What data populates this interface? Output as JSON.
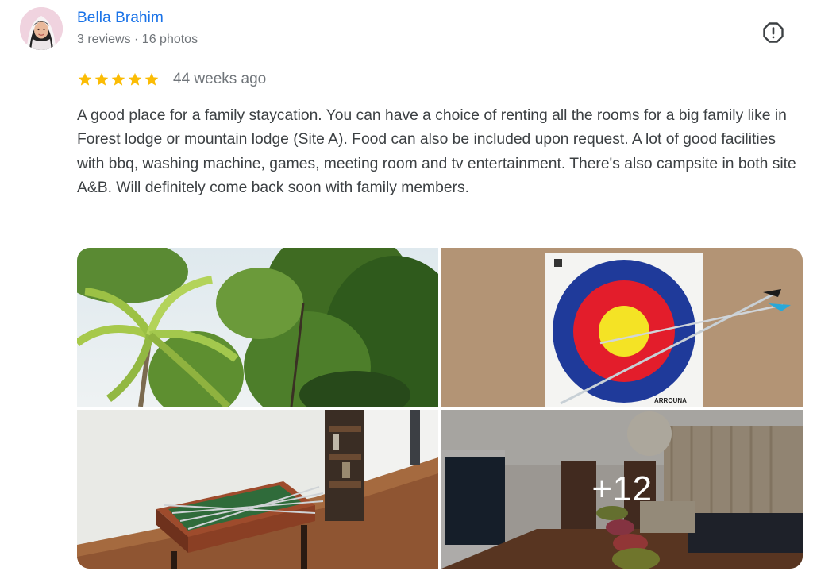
{
  "reviewer": {
    "name": "Bella Brahim",
    "meta": "3 reviews · 16 photos"
  },
  "review": {
    "rating": 5,
    "rating_max": 5,
    "date": "44 weeks ago",
    "text": "A good place for a family staycation. You can have a choice of renting all the rooms for a big family like in Forest lodge or mountain lodge (Site A). Food can also be included upon request. A lot of good facilities with bbq, washing machine, games, meeting room and tv entertainment. There's also campsite in both site A&B. Will definitely come back soon with family members."
  },
  "photos": {
    "more_count": "+12",
    "target_brand": "ARROUNA"
  },
  "icons": {
    "report": "report-flag-icon",
    "star": "star-icon"
  },
  "colors": {
    "name_link": "#1a73e8",
    "star": "#fbbc04",
    "secondary_text": "#70757a",
    "body_text": "#3c4043"
  }
}
